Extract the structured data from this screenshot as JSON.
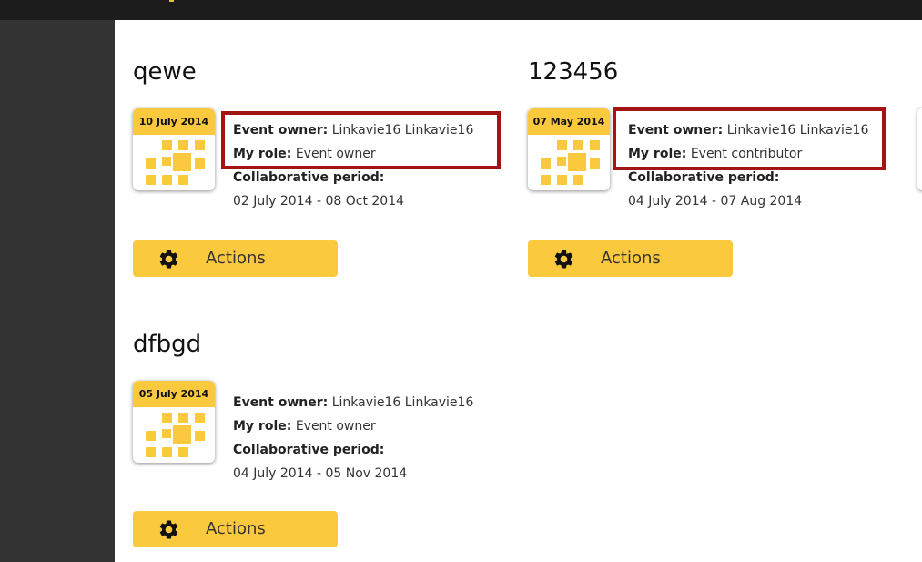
{
  "events": [
    {
      "title": "qewe",
      "date": "10 July 2014",
      "owner_label": "Event owner",
      "owner": "Linkavie16 Linkavie16",
      "role_label": "My role",
      "role": "Event owner",
      "period_label": "Collaborative period",
      "period": "02 July 2014 - 08 Oct 2014",
      "actions_label": "Actions"
    },
    {
      "title": "123456",
      "date": "07 May 2014",
      "owner_label": "Event owner",
      "owner": "Linkavie16 Linkavie16",
      "role_label": "My role",
      "role": "Event contributor",
      "period_label": "Collaborative period",
      "period": "04 July 2014 - 07 Aug 2014",
      "actions_label": "Actions"
    },
    {
      "title": "dfbgd",
      "date": "05 July 2014",
      "owner_label": "Event owner",
      "owner": "Linkavie16 Linkavie16",
      "role_label": "My role",
      "role": "Event owner",
      "period_label": "Collaborative period",
      "period": "04 July 2014 - 05 Nov 2014",
      "actions_label": "Actions"
    }
  ],
  "colors": {
    "accent": "#fbc93d",
    "highlight": "#a31515",
    "sidebar": "#333333",
    "topbar": "#1c1c1c"
  },
  "icons": {
    "calendar": "calendar-icon",
    "actions": "gear-icon"
  }
}
